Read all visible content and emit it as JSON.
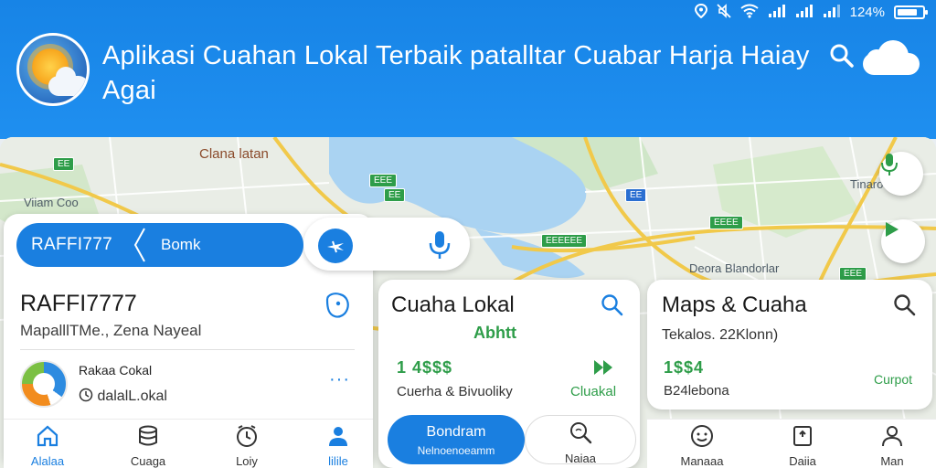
{
  "status_bar": {
    "battery": "124%",
    "icons": [
      "location-icon",
      "mute-icon",
      "wifi-icon",
      "signal-icon",
      "signal-icon",
      "signal-icon",
      "battery-icon"
    ]
  },
  "header": {
    "title": "Aplikasi Cuahan Lokal Terbaik patalltar Cuabar Harja Haiay Agai"
  },
  "map": {
    "labels": [
      "Clana latan",
      "Viiam Coo",
      "Tinaro",
      "Deora Blandorlar"
    ]
  },
  "search": {
    "user": "RAFFI777",
    "value": "Bomk"
  },
  "left_card": {
    "name": "RAFFI7777",
    "subtitle": "MapalllTMe., Zena Nayeal",
    "app_title": "Rakaa Cokal",
    "app_subtitle": "dalalL.okal",
    "more": "···"
  },
  "bottom_nav_left": [
    {
      "label": "Alalaa",
      "icon": "home-icon"
    },
    {
      "label": "Cuaga",
      "icon": "layers-icon"
    },
    {
      "label": "Loiy",
      "icon": "clock-icon"
    },
    {
      "label": "lilile",
      "icon": "profile-icon"
    }
  ],
  "mid_card": {
    "title": "Cuaha Lokal",
    "subtitle": "Abhtt",
    "price": "1 4$$$",
    "description": "Cuerha & Bivuoliky",
    "action": "Cluakal",
    "primary_btn": "Bondram",
    "primary_btn_sub": "Nelnoenoeamm",
    "secondary_btn": "Naiaa"
  },
  "right_card": {
    "title": "Maps & Cuaha",
    "subtitle": "Tekalos. 22Klonn)",
    "price": "1$$4",
    "description": "B24lebona",
    "action": "Curpot"
  },
  "bottom_nav_right": [
    {
      "label": "Manaaa",
      "icon": "smile-icon"
    },
    {
      "label": "Daiia",
      "icon": "bookmark-icon"
    },
    {
      "label": "Man",
      "icon": "account-icon"
    }
  ],
  "colors": {
    "primary": "#1a7fe0",
    "header": "#1f8ff0",
    "accent_green": "#2e9d49"
  }
}
